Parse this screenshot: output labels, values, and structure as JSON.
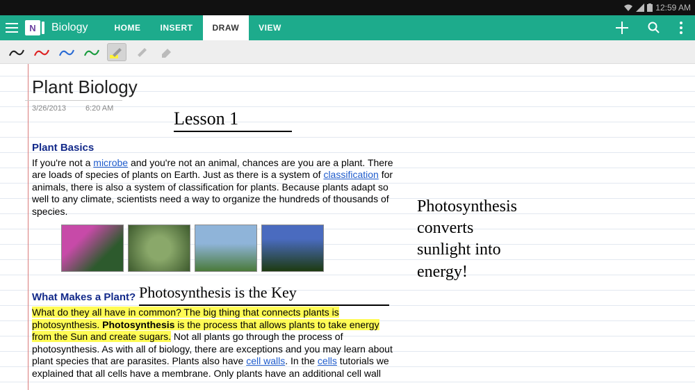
{
  "status": {
    "time": "12:59 AM"
  },
  "app": {
    "logo_letter": "N",
    "notebook": "Biology",
    "tabs": [
      "HOME",
      "INSERT",
      "DRAW",
      "VIEW"
    ],
    "active_tab": "DRAW"
  },
  "tools": {
    "pens": [
      {
        "name": "pen-black",
        "color": "#222",
        "selected": false
      },
      {
        "name": "pen-red",
        "color": "#d22",
        "selected": false
      },
      {
        "name": "pen-blue",
        "color": "#2a6bd4",
        "selected": false
      },
      {
        "name": "pen-green",
        "color": "#1a9b3e",
        "selected": false
      }
    ],
    "highlighter": {
      "name": "highlighter-yellow",
      "selected": true
    },
    "marker": {
      "name": "marker-gray",
      "selected": false
    },
    "eraser": {
      "name": "eraser",
      "selected": false
    }
  },
  "page": {
    "title": "Plant Biology",
    "date": "3/26/2013",
    "time": "6:20 AM"
  },
  "content": {
    "sec1_heading": "Plant Basics",
    "sec1_p_a": "If you're not a ",
    "sec1_link_microbe": "microbe",
    "sec1_p_b": " and you're not an animal, chances are you are a plant. There are loads of species of plants on Earth. Just as there is a system of ",
    "sec1_link_classification": "classification",
    "sec1_p_c": " for animals, there is also a system of classification for plants. Because plants adapt so well to any climate, scientists need a way to organize the hundreds of thousands of species.",
    "sec2_heading": "What Makes a Plant?",
    "sec2_hl_a": "What do they all have in common? The big thing that connects plants is photosynthesis. ",
    "sec2_hl_bold": "Photosynthesis",
    "sec2_hl_b": " is the process that allows plants to take energy from the Sun and create sugars.",
    "sec2_p_a": " Not all plants go through the process of photosynthesis. As with all of biology, there are exceptions and you may learn about plant species that are parasites. Plants also have ",
    "sec2_link_cellwalls": "cell walls",
    "sec2_p_b": ". In the ",
    "sec2_link_cells": "cells",
    "sec2_p_c": " tutorials we explained that all cells have a membrane. Only plants have an additional cell wall"
  },
  "handwriting": {
    "lesson": "Lesson 1",
    "key": "Photosynthesis is the Key",
    "note": "Photosynthesis\nconverts\nsunlight into\nenergy!"
  }
}
